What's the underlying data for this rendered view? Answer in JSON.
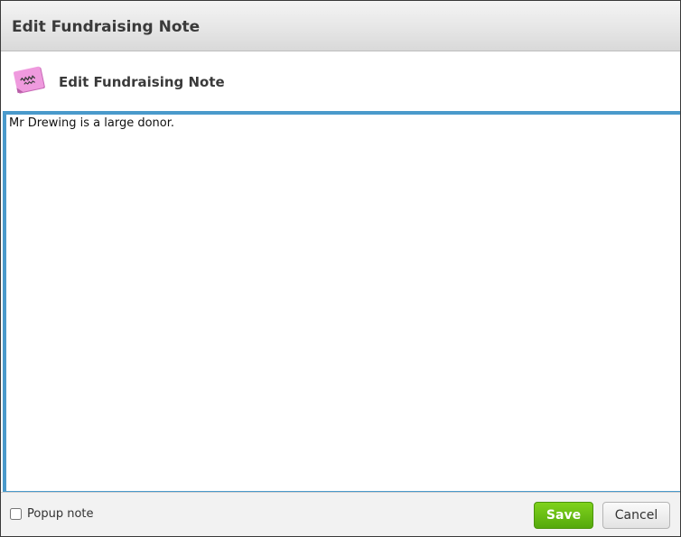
{
  "window": {
    "title": "Edit Fundraising Note"
  },
  "header": {
    "icon": "sticky-note-icon",
    "title": "Edit Fundraising Note"
  },
  "note": {
    "value": "Mr Drewing is a large donor."
  },
  "footer": {
    "popup_label": "Popup note",
    "popup_checked": false,
    "save_label": "Save",
    "cancel_label": "Cancel"
  },
  "colors": {
    "accent_border": "#4a9acb",
    "save_button": "#6cc014",
    "note_icon": "#e98fd6"
  }
}
